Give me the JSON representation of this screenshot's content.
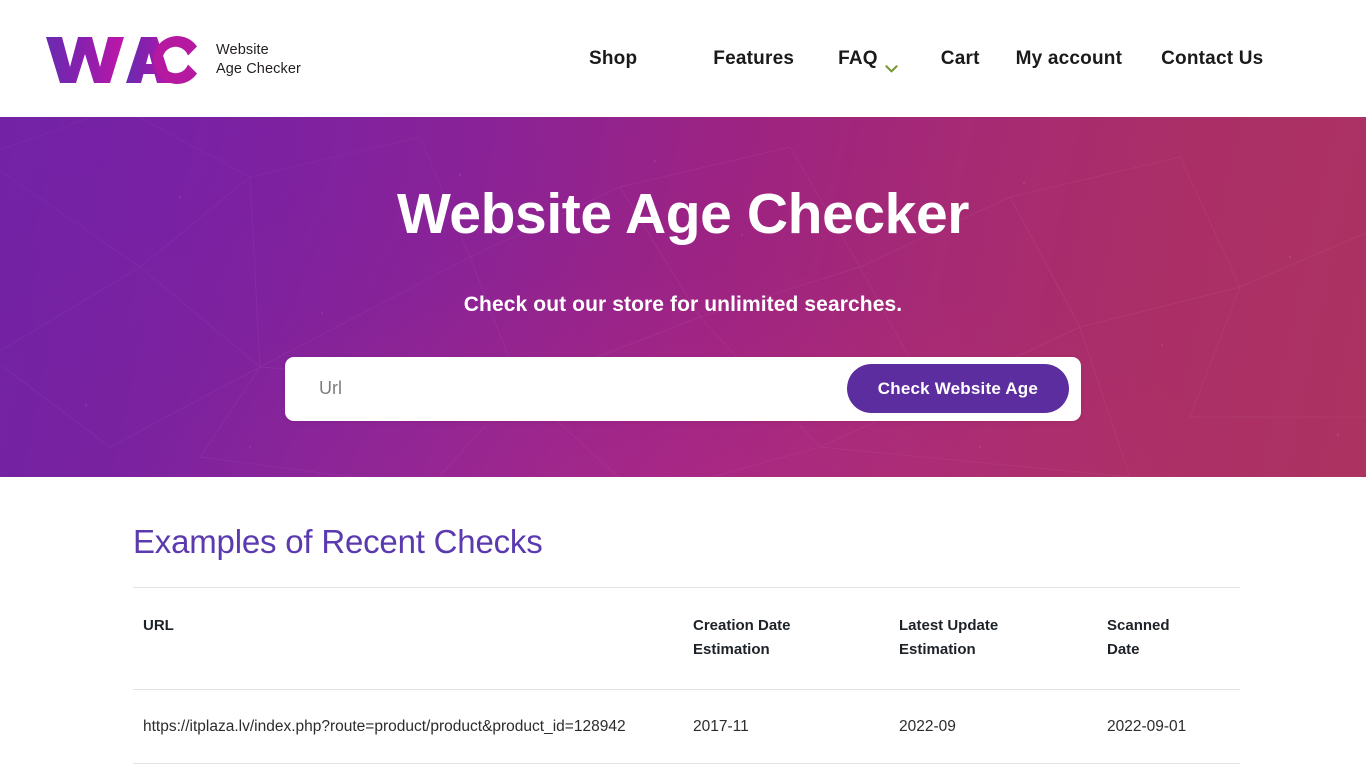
{
  "header": {
    "logo": {
      "mark_text": "WAC",
      "icon": "clock-in-letter-c-icon",
      "tagline_line1": "Website",
      "tagline_line2": "Age Checker",
      "gradient_start": "#6a2bb0",
      "gradient_end": "#c016a8"
    },
    "nav": [
      {
        "label": "Shop",
        "has_dropdown": false
      },
      {
        "label": "Features",
        "has_dropdown": false
      },
      {
        "label": "FAQ",
        "has_dropdown": true,
        "chevron_color": "#7a9a3a"
      },
      {
        "label": "Cart",
        "has_dropdown": false
      },
      {
        "label": "My account",
        "has_dropdown": false
      },
      {
        "label": "Contact Us",
        "has_dropdown": false
      }
    ]
  },
  "hero": {
    "title": "Website Age Checker",
    "subtitle": "Check out our store for unlimited searches.",
    "gradient_left": "#7123a3",
    "gradient_right": "#ac3262",
    "search": {
      "placeholder": "Url",
      "value": "",
      "button_label": "Check Website Age",
      "button_color": "#5b2d9e"
    }
  },
  "results": {
    "section_title": "Examples of Recent Checks",
    "title_color": "#5b3ab0",
    "table": {
      "columns": [
        "URL",
        "Creation Date Estimation",
        "Latest Update Estimation",
        "Scanned Date"
      ],
      "columns_split": [
        {
          "line1": "URL",
          "line2": ""
        },
        {
          "line1": "Creation Date",
          "line2": "Estimation"
        },
        {
          "line1": "Latest Update",
          "line2": "Estimation"
        },
        {
          "line1": "Scanned",
          "line2": "Date"
        }
      ],
      "rows": [
        {
          "url": "https://itplaza.lv/index.php?route=product/product&product_id=128942",
          "creation_date_estimation": "2017-11",
          "latest_update_estimation": "2022-09",
          "scanned_date": "2022-09-01"
        }
      ]
    }
  }
}
